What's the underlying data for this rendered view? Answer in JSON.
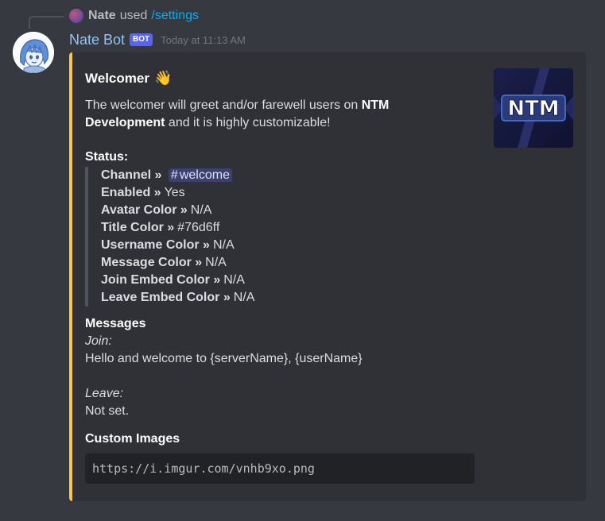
{
  "interaction": {
    "user": "Nate",
    "verb": "used",
    "command": "/settings"
  },
  "author": {
    "name": "Nate Bot",
    "tag": "BOT",
    "timestamp": "Today at 11:13 AM"
  },
  "embed": {
    "color": "#f5c842",
    "title": "Welcomer",
    "title_emoji": "👋",
    "thumbnail_text": "NTM",
    "description": {
      "before": "The welcomer will greet and/or farewell users on ",
      "bold": "NTM Development",
      "after": " and it is highly customizable!"
    },
    "status_label": "Status:",
    "status_rows": [
      {
        "key": "Channel »",
        "value": "welcome",
        "mention": true
      },
      {
        "key": "Enabled »",
        "value": "Yes"
      },
      {
        "key": "Avatar Color »",
        "value": "N/A"
      },
      {
        "key": "Title Color »",
        "value": "#76d6ff"
      },
      {
        "key": "Username Color »",
        "value": "N/A"
      },
      {
        "key": "Message Color »",
        "value": "N/A"
      },
      {
        "key": "Join Embed Color »",
        "value": "N/A"
      },
      {
        "key": "Leave Embed Color »",
        "value": "N/A"
      }
    ],
    "messages": {
      "name": "Messages",
      "join_label": "Join:",
      "join_text": "Hello and welcome to {serverName}, {userName}",
      "leave_label": "Leave:",
      "leave_text": "Not set."
    },
    "custom_images": {
      "name": "Custom Images",
      "url": "https://i.imgur.com/vnhb9xo.png"
    }
  }
}
